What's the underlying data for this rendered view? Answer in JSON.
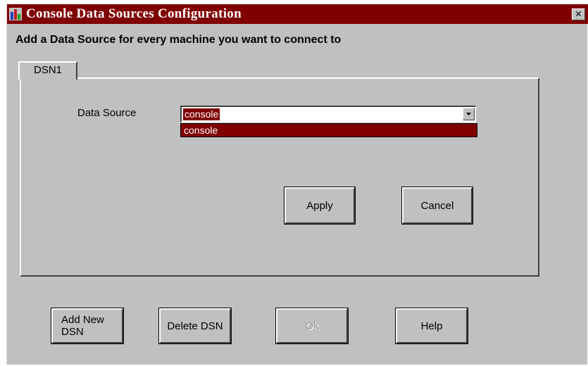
{
  "window": {
    "title": "Console Data Sources Configuration",
    "close_label": "✕",
    "accent_color": "#800000",
    "background_color": "#c0c0c0"
  },
  "instruction": "Add a Data Source for every machine you want to connect to",
  "tabs": [
    {
      "label": "DSN1",
      "selected": true
    }
  ],
  "form": {
    "data_source_label": "Data Source",
    "data_source_value": "console",
    "dropdown_options": [
      "console"
    ]
  },
  "panel_buttons": {
    "apply_label": "Apply",
    "cancel_label": "Cancel"
  },
  "footer_buttons": {
    "add_new_dsn_label": "Add New\nDSN",
    "delete_dsn_label": "Delete DSN",
    "ok_label": "Ok",
    "ok_enabled": false,
    "help_label": "Help"
  },
  "icons": {
    "app": "bar-chart-icon",
    "close": "close-icon",
    "dropdown": "chevron-down-icon"
  }
}
